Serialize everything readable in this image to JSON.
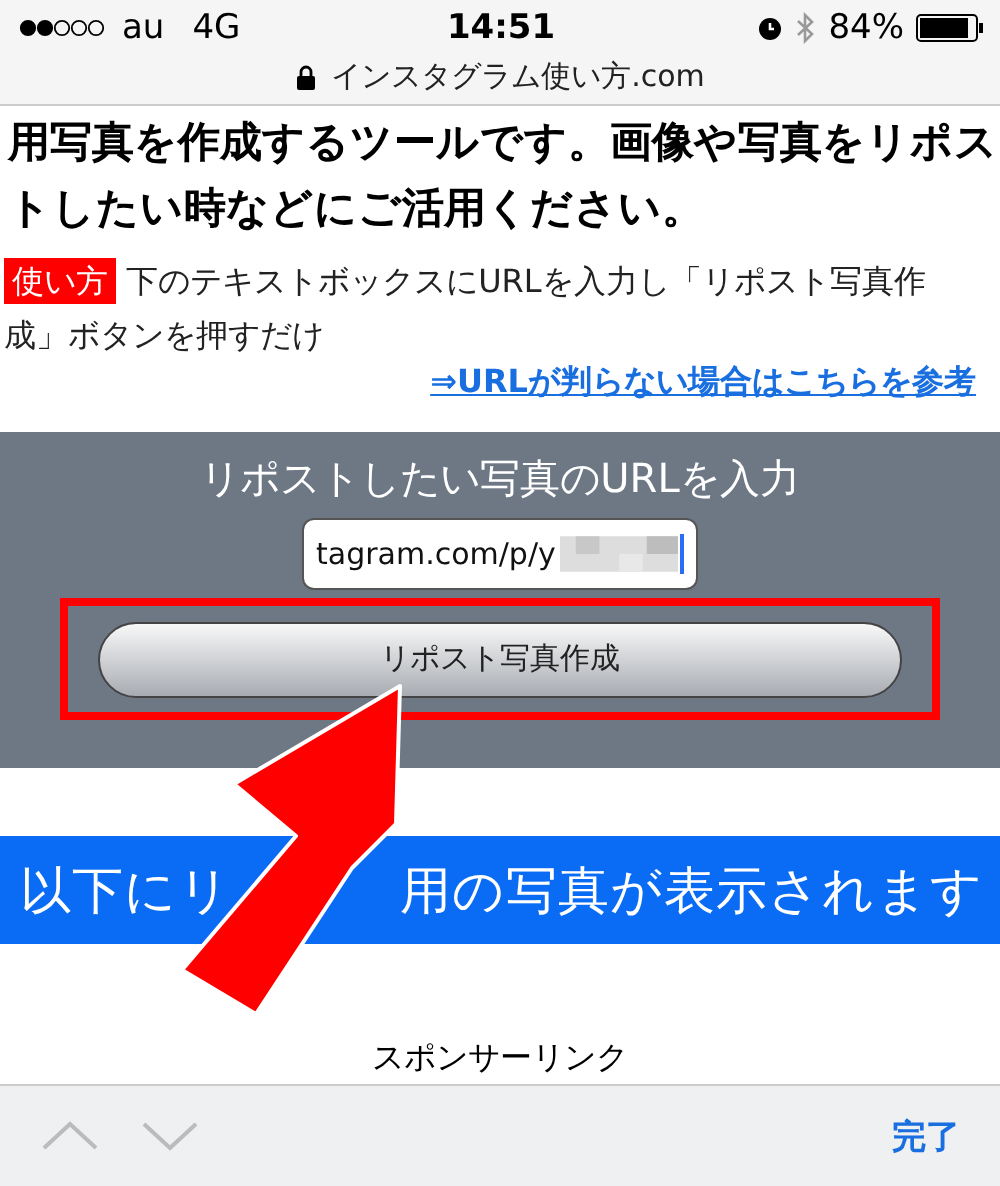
{
  "status_bar": {
    "carrier": "au",
    "network": "4G",
    "time": "14:51",
    "battery": "84%"
  },
  "address_bar": {
    "domain": "インスタグラム使い方.com"
  },
  "intro": {
    "lines": [
      "用写真を作成するツールです。画像や写真をリポス",
      "トしたい時などにご活用ください。"
    ]
  },
  "usage": {
    "tag": "使い方",
    "text": "下のテキストボックスにURLを入力し「リポスト写真作成」ボタンを押すだけ"
  },
  "help_link": "⇒URLが判らない場合はこちらを参考",
  "form": {
    "title": "リポストしたい写真のURLを入力",
    "url_value": "tagram.com/p/y",
    "button": "リポスト写真作成",
    "highlighted": true
  },
  "banner": {
    "parts": [
      "以下にリ",
      "用の写真が表示されます"
    ]
  },
  "sponsor": "スポンサーリンク",
  "keyboard_toolbar": {
    "done": "完了"
  }
}
